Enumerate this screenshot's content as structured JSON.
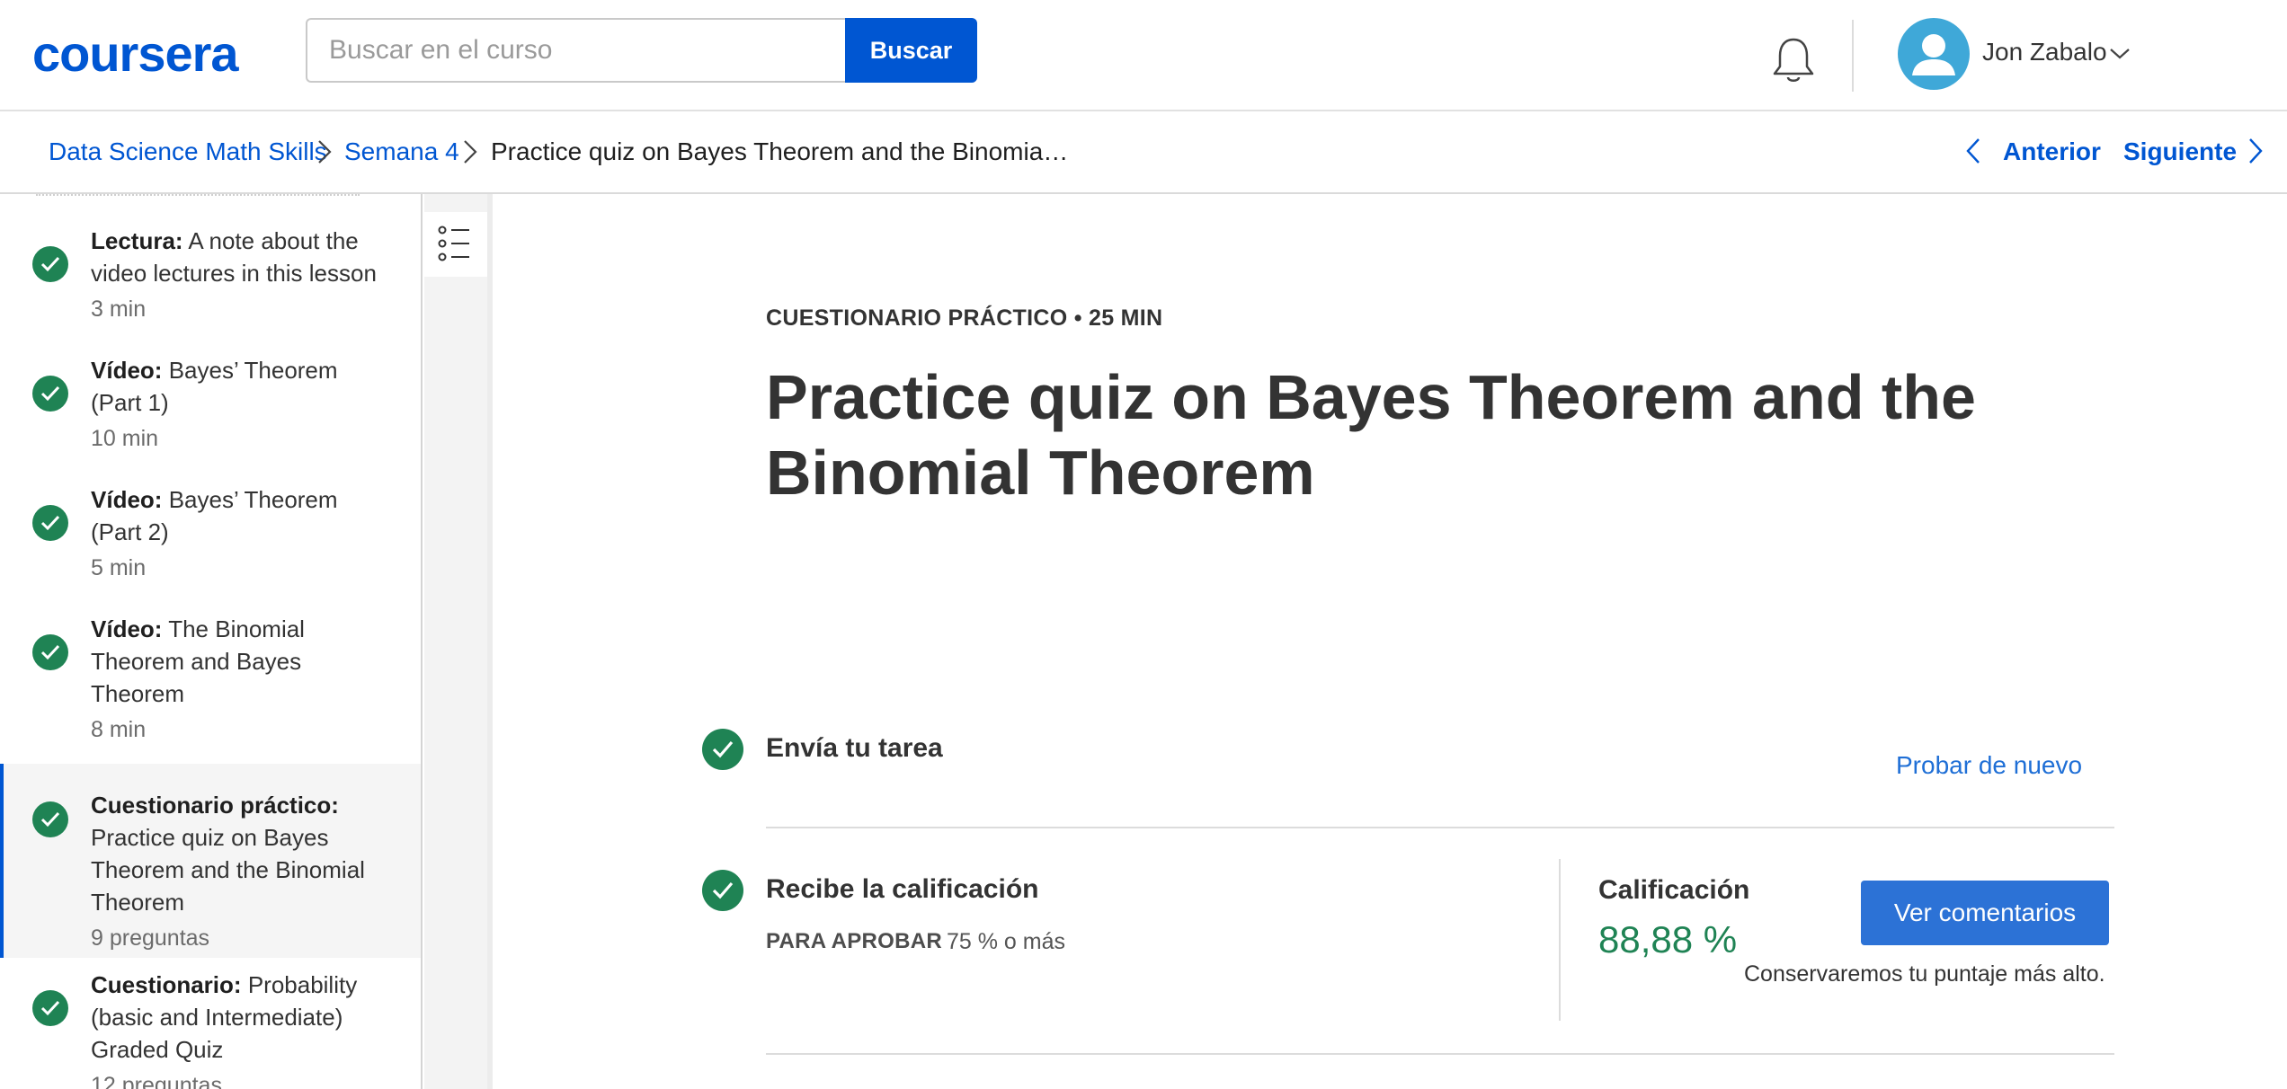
{
  "header": {
    "logo": "coursera",
    "search_placeholder": "Buscar en el curso",
    "search_button": "Buscar",
    "user_name": "Jon Zabalo"
  },
  "breadcrumb": {
    "items": [
      "Data Science Math Skills",
      "Semana 4",
      "Practice quiz on Bayes Theorem and the Binomia…"
    ],
    "prev": "Anterior",
    "next": "Siguiente"
  },
  "sidebar": {
    "items": [
      {
        "type": "Lectura:",
        "title": "A note about the video lectures in this lesson",
        "meta": "3 min",
        "completed": true
      },
      {
        "type": "Vídeo:",
        "title": "Bayes’ Theorem (Part 1)",
        "meta": "10 min",
        "completed": true
      },
      {
        "type": "Vídeo:",
        "title": "Bayes’ Theorem (Part 2)",
        "meta": "5 min",
        "completed": true
      },
      {
        "type": "Vídeo:",
        "title": "The Binomial Theorem and Bayes Theorem",
        "meta": "8 min",
        "completed": true
      },
      {
        "type": "Cuestionario práctico:",
        "title": "Practice quiz on Bayes Theorem and the Binomial Theorem",
        "meta": "9 preguntas",
        "completed": true,
        "active": true
      },
      {
        "type": "Cuestionario:",
        "title": "Probability (basic and Intermediate) Graded Quiz",
        "meta": "12 preguntas",
        "completed": true
      }
    ]
  },
  "main": {
    "kicker": "CUESTIONARIO PRÁCTICO • 25 MIN",
    "title": "Practice quiz on Bayes Theorem and the Binomial Theorem",
    "submit": {
      "label": "Envía tu tarea",
      "action": "Probar de nuevo"
    },
    "grade": {
      "label": "Recibe la calificación",
      "pass_label": "PARA APROBAR",
      "pass_value": "75 % o más",
      "score_label": "Calificación",
      "score_value": "88,88 %",
      "feedback_button": "Ver comentarios",
      "note": "Conservaremos tu puntaje más alto."
    }
  },
  "colors": {
    "brand": "#0056d2",
    "success": "#1f8354",
    "avatar": "#3fa8d8"
  },
  "icons": [
    "bell-icon",
    "user-avatar-icon",
    "chevron-down-icon",
    "chevron-right-icon",
    "chevron-left-icon",
    "check-circle-icon",
    "list-outline-icon"
  ]
}
